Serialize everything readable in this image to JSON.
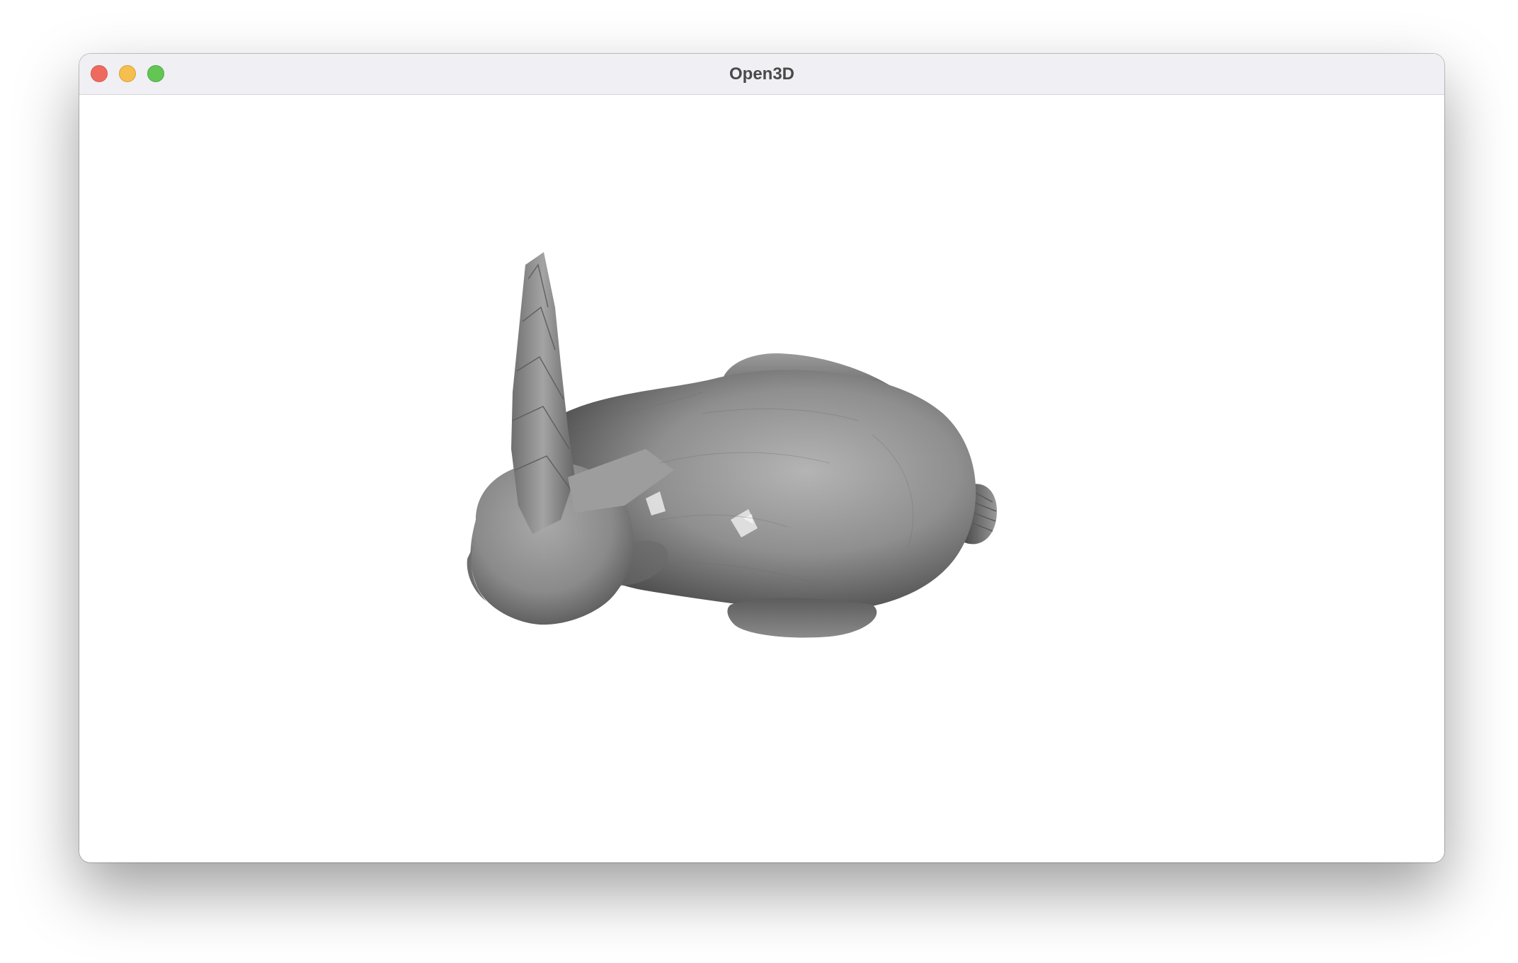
{
  "window": {
    "title": "Open3D",
    "controls": [
      {
        "name": "close",
        "color": "#ee6a5f",
        "border": "#d6584d"
      },
      {
        "name": "minimize",
        "color": "#f5be4f",
        "border": "#d9a23a"
      },
      {
        "name": "zoom",
        "color": "#62c554",
        "border": "#4ea943"
      }
    ]
  },
  "viewport": {
    "background": "#ffffff",
    "model": "bunny-mesh",
    "mesh_color": "#8e8e8e"
  }
}
